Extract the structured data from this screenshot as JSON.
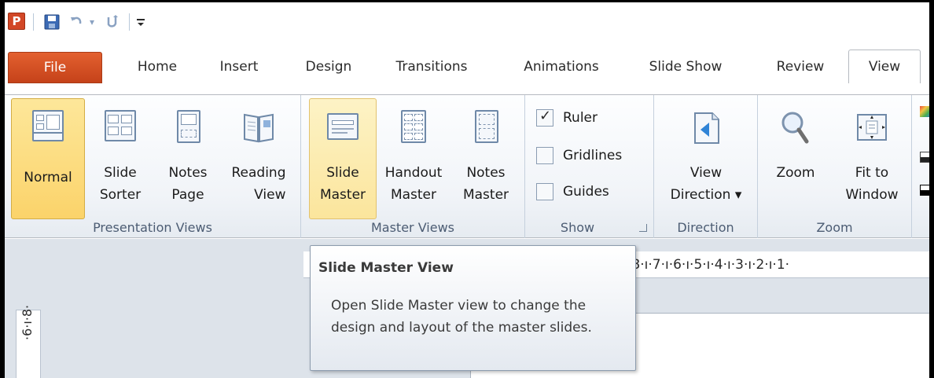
{
  "qat": {
    "logo_letter": "P",
    "icons": [
      "powerpoint-logo-icon",
      "save-icon",
      "undo-icon",
      "undo-dropdown-icon",
      "repeat-icon",
      "customize-qat-icon"
    ]
  },
  "tabs": [
    {
      "label": "File"
    },
    {
      "label": "Home"
    },
    {
      "label": "Insert"
    },
    {
      "label": "Design"
    },
    {
      "label": "Transitions"
    },
    {
      "label": "Animations"
    },
    {
      "label": "Slide Show"
    },
    {
      "label": "Review"
    },
    {
      "label": "View"
    }
  ],
  "active_tab": "View",
  "ribbon": {
    "presentation_views": {
      "label": "Presentation Views",
      "normal": "Normal",
      "slide_sorter_1": "Slide",
      "slide_sorter_2": "Sorter",
      "notes_page_1": "Notes",
      "notes_page_2": "Page",
      "reading_view_1": "Reading",
      "reading_view_2": "View"
    },
    "master_views": {
      "label": "Master Views",
      "slide_master_1": "Slide",
      "slide_master_2": "Master",
      "handout_master_1": "Handout",
      "handout_master_2": "Master",
      "notes_master_1": "Notes",
      "notes_master_2": "Master"
    },
    "show": {
      "label": "Show",
      "ruler": "Ruler",
      "ruler_checked": true,
      "gridlines": "Gridlines",
      "gridlines_checked": false,
      "guides": "Guides",
      "guides_checked": false
    },
    "direction": {
      "label": "Direction",
      "view_1": "View",
      "view_2": "Direction ▾"
    },
    "zoom": {
      "label": "Zoom",
      "zoom": "Zoom",
      "fit_1": "Fit to",
      "fit_2": "Window"
    }
  },
  "ruler": {
    "horizontal_text": "·8·ı·7·ı·6·ı·5·ı·4·ı·3·ı·2·ı·1·",
    "vertical_text": "·6·ı·8·"
  },
  "tooltip": {
    "title": "Slide Master View",
    "body": "Open Slide Master view to change the design and layout of the master slides."
  },
  "colors": {
    "file_tab": "#d24726",
    "selected_button": "#fbd36a",
    "ribbon_text": "#1b1b1b"
  }
}
